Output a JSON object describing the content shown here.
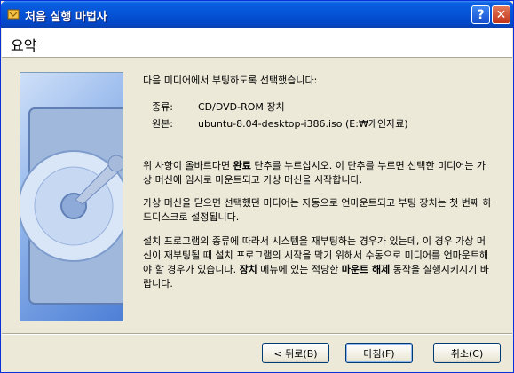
{
  "window": {
    "title": "처음 실행 마법사"
  },
  "header": {
    "title": "요약"
  },
  "content": {
    "intro": "다음 미디어에서 부팅하도록 선택했습니다:",
    "type_label": "종류:",
    "type_value": "CD/DVD-ROM 장치",
    "source_label": "원본:",
    "source_value": "ubuntu-8.04-desktop-i386.iso (E:₩개인자료)",
    "para1_a": "위 사항이 올바르다면 ",
    "para1_bold": "완료",
    "para1_b": " 단추를 누르십시오. 이 단추를 누르면 선택한 미디어는 가상 머신에 임시로 마운트되고 가상 머신을 시작합니다.",
    "para2": "가상 머신을 닫으면 선택했던 미디어는 자동으로 언마운트되고 부팅 장치는 첫 번째 하드디스크로 설정됩니다.",
    "para3_a": "설치 프로그램의 종류에 따라서 시스템을 재부팅하는 경우가 있는데, 이 경우 가상 머신이 재부팅될 때 설치 프로그램의 시작을 막기 위해서 수동으로 미디어를 언마운트해야 할 경우가 있습니다. ",
    "para3_bold1": "장치",
    "para3_b": " 메뉴에 있는 적당한 ",
    "para3_bold2": "마운트 해제",
    "para3_c": " 동작을 실행시키시기 바랍니다."
  },
  "buttons": {
    "back": "< 뒤로(B)",
    "finish": "마침(F)",
    "cancel": "취소(C)"
  },
  "titlebar_buttons": {
    "help": "?",
    "close": "✕"
  }
}
